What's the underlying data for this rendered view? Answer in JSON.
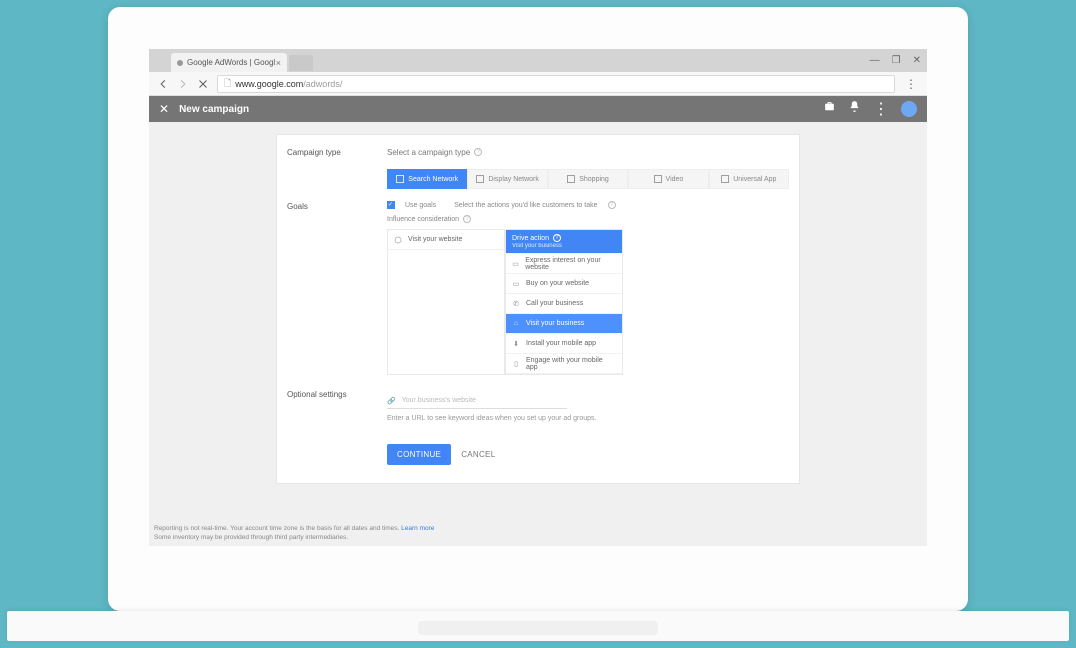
{
  "browser": {
    "tab_title": "Google AdWords | Googl",
    "url_host": "www.google.com",
    "url_path": "/adwords/"
  },
  "appbar": {
    "title": "New campaign"
  },
  "sections": {
    "campaign_type": {
      "label": "Campaign type",
      "prompt": "Select a campaign type",
      "tabs": [
        "Search Network",
        "Display Network",
        "Shopping",
        "Video",
        "Universal App"
      ],
      "active": 0
    },
    "goals": {
      "label": "Goals",
      "use_goals": "Use goals",
      "select_prompt": "Select the actions you'd like customers to take",
      "left_panel": {
        "header": "Influence consideration",
        "items": [
          "Visit your website"
        ]
      },
      "right_panel": {
        "header": "Drive action",
        "header_sub": "Visit your business",
        "items": [
          "Express interest on your website",
          "Buy on your website",
          "Call your business",
          "Visit your business",
          "Install your mobile app",
          "Engage with your mobile app"
        ],
        "highlight_index": 3
      }
    },
    "optional": {
      "label": "Optional settings",
      "url_placeholder": "Your business's website",
      "hint": "Enter a URL to see keyword ideas when you set up your ad groups."
    }
  },
  "actions": {
    "continue": "CONTINUE",
    "cancel": "CANCEL"
  },
  "footer": {
    "line1": "Reporting is not real-time. Your account time zone is the basis for all dates and times. ",
    "learn": "Learn more",
    "line2": "Some inventory may be provided through third party intermediaries."
  }
}
